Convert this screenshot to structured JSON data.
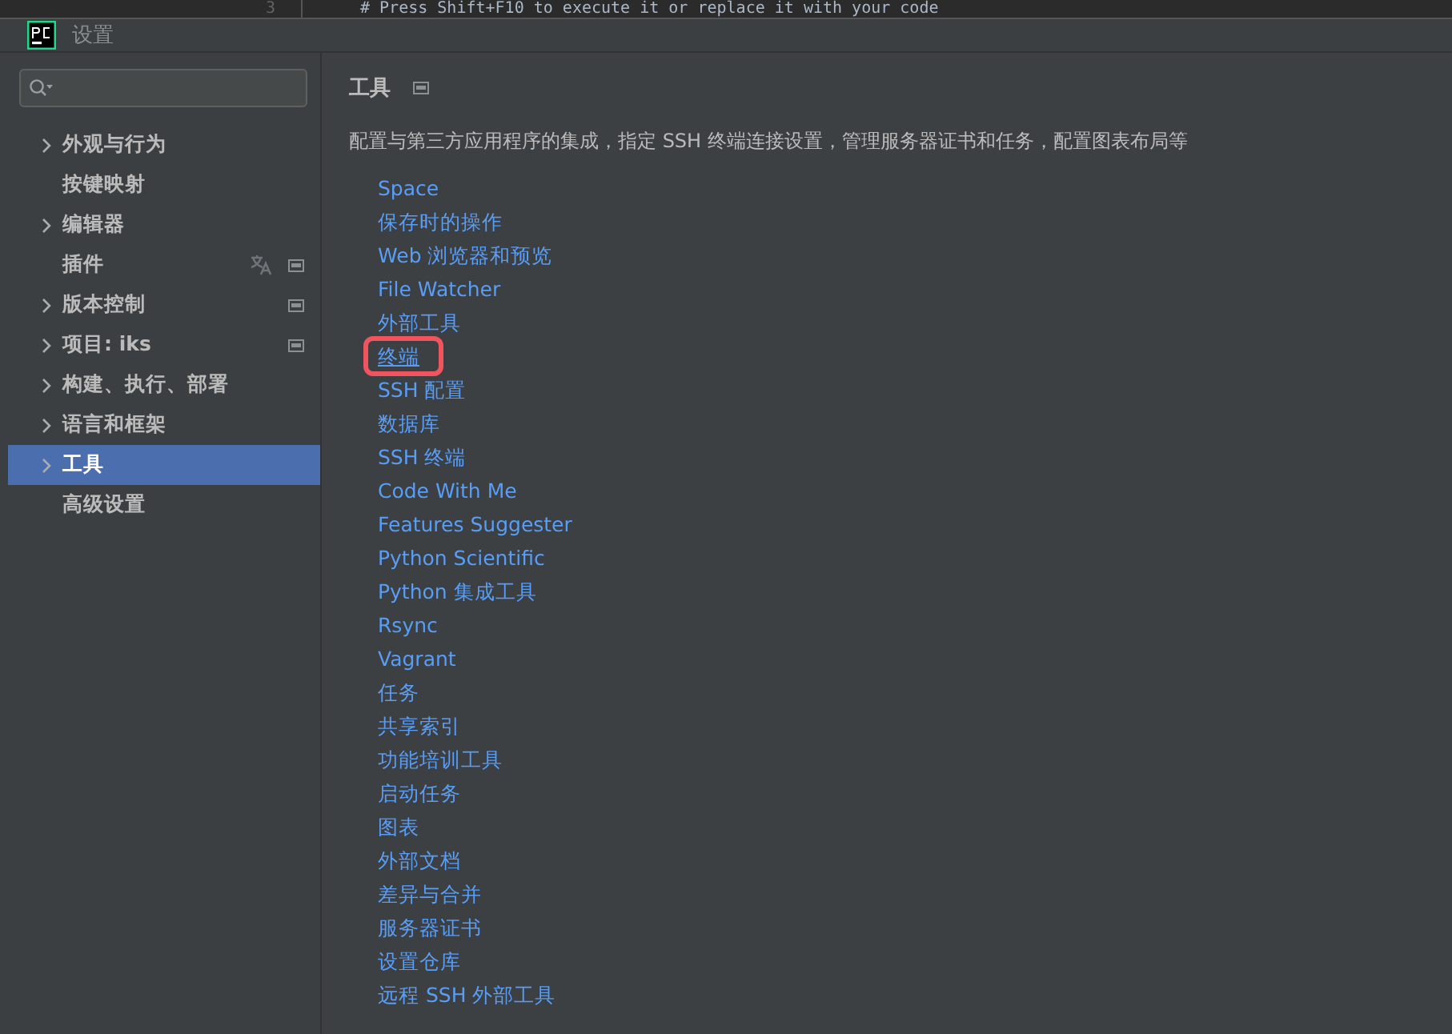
{
  "editor_behind": {
    "line_number": "3",
    "code": "# Press Shift+F10 to execute it or replace it with your code"
  },
  "window": {
    "title": "设置"
  },
  "sidebar": {
    "items": [
      {
        "label": "外观与行为",
        "expandable": true,
        "selected": false,
        "translate_icon": false,
        "project_icon": false
      },
      {
        "label": "按键映射",
        "expandable": false,
        "selected": false,
        "translate_icon": false,
        "project_icon": false
      },
      {
        "label": "编辑器",
        "expandable": true,
        "selected": false,
        "translate_icon": false,
        "project_icon": false
      },
      {
        "label": "插件",
        "expandable": false,
        "selected": false,
        "translate_icon": true,
        "project_icon": true
      },
      {
        "label": "版本控制",
        "expandable": true,
        "selected": false,
        "translate_icon": false,
        "project_icon": true
      },
      {
        "label": "项目: iks",
        "expandable": true,
        "selected": false,
        "translate_icon": false,
        "project_icon": true
      },
      {
        "label": "构建、执行、部署",
        "expandable": true,
        "selected": false,
        "translate_icon": false,
        "project_icon": false
      },
      {
        "label": "语言和框架",
        "expandable": true,
        "selected": false,
        "translate_icon": false,
        "project_icon": false
      },
      {
        "label": "工具",
        "expandable": true,
        "selected": true,
        "translate_icon": false,
        "project_icon": false
      },
      {
        "label": "高级设置",
        "expandable": false,
        "selected": false,
        "translate_icon": false,
        "project_icon": false
      }
    ]
  },
  "content": {
    "title": "工具",
    "description": "配置与第三方应用程序的集成，指定 SSH 终端连接设置，管理服务器证书和任务，配置图表布局等",
    "links": [
      {
        "label": "Space",
        "highlighted": false
      },
      {
        "label": "保存时的操作",
        "highlighted": false
      },
      {
        "label": "Web 浏览器和预览",
        "highlighted": false
      },
      {
        "label": "File Watcher",
        "highlighted": false
      },
      {
        "label": "外部工具",
        "highlighted": false
      },
      {
        "label": "终端",
        "highlighted": true
      },
      {
        "label": "SSH 配置",
        "highlighted": false
      },
      {
        "label": "数据库",
        "highlighted": false
      },
      {
        "label": "SSH 终端",
        "highlighted": false
      },
      {
        "label": "Code With Me",
        "highlighted": false
      },
      {
        "label": "Features Suggester",
        "highlighted": false
      },
      {
        "label": "Python Scientific",
        "highlighted": false
      },
      {
        "label": "Python 集成工具",
        "highlighted": false
      },
      {
        "label": "Rsync",
        "highlighted": false
      },
      {
        "label": "Vagrant",
        "highlighted": false
      },
      {
        "label": "任务",
        "highlighted": false
      },
      {
        "label": "共享索引",
        "highlighted": false
      },
      {
        "label": "功能培训工具",
        "highlighted": false
      },
      {
        "label": "启动任务",
        "highlighted": false
      },
      {
        "label": "图表",
        "highlighted": false
      },
      {
        "label": "外部文档",
        "highlighted": false
      },
      {
        "label": "差异与合并",
        "highlighted": false
      },
      {
        "label": "服务器证书",
        "highlighted": false
      },
      {
        "label": "设置仓库",
        "highlighted": false
      },
      {
        "label": "远程 SSH 外部工具",
        "highlighted": false
      }
    ]
  }
}
